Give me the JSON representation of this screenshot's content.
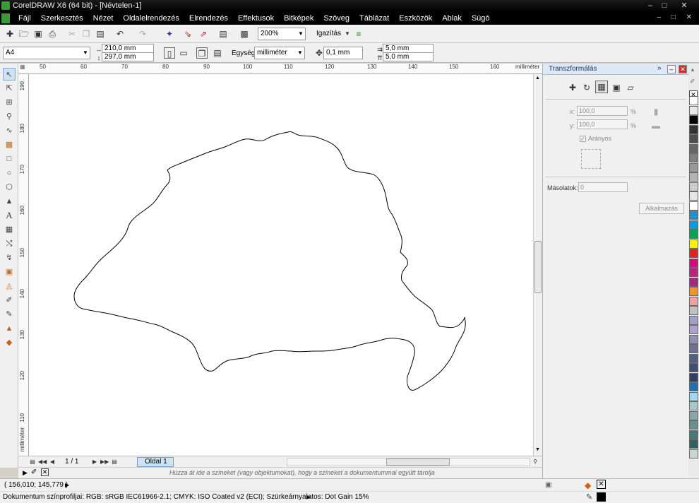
{
  "titlebar": {
    "title": "CorelDRAW X6 (64 bit) - [Névtelen-1]",
    "controls": [
      "minimize-icon",
      "maximize-icon",
      "close-icon"
    ]
  },
  "menubar": {
    "items": [
      "Fájl",
      "Szerkesztés",
      "Nézet",
      "Oldalelrendezés",
      "Elrendezés",
      "Effektusok",
      "Bitképek",
      "Szöveg",
      "Táblázat",
      "Eszközök",
      "Ablak",
      "Súgó"
    ]
  },
  "stdbar": {
    "zoom": "200%",
    "snap_label": "Igazítás"
  },
  "propbar": {
    "page_size": "A4",
    "width": "210,0 mm",
    "height": "297,0 mm",
    "units_label": "Egység:",
    "units": "milliméter",
    "nudge": "0,1 mm",
    "dup_x": "5,0 mm",
    "dup_y": "5,0 mm"
  },
  "ruler": {
    "h_ticks": [
      "50",
      "60",
      "70",
      "80",
      "90",
      "100",
      "110",
      "120",
      "130",
      "140",
      "150",
      "160"
    ],
    "h_unit": "milliméter",
    "v_ticks": [
      "190",
      "180",
      "170",
      "160",
      "150",
      "140",
      "130",
      "120",
      "110"
    ],
    "v_unit": "milliméter"
  },
  "pagenav": {
    "count": "1 / 1",
    "tab": "Oldal 1"
  },
  "hint": "Húzza át ide a színeket (vagy objektumokat), hogy a színeket a dokumentummal együtt tárolja",
  "docker": {
    "title": "Transzformálás",
    "x_label": "x:",
    "x_value": "100,0",
    "y_label": "y:",
    "y_value": "100,0",
    "pct": "%",
    "proportional": "Arányos",
    "copies_label": "Másolatok:",
    "copies_value": "0",
    "apply": "Alkalmazás"
  },
  "status": {
    "coords": "( 156,010; 145,779 )",
    "profile": "Dokumentum színprofiljai: RGB: sRGB IEC61966-2.1; CMYK: ISO Coated v2 (ECI); Szürkeárnyalatos: Dot Gain 15%"
  },
  "palette": [
    "#ffffff",
    "#e8e8e8",
    "#000000",
    "#333333",
    "#4d4d4d",
    "#666666",
    "#808080",
    "#999999",
    "#b3b3b3",
    "#cccccc",
    "#e6e6e6",
    "#ffffff",
    "#1e90d0",
    "#00a0e0",
    "#00a651",
    "#fff200",
    "#ed1c24",
    "#e00080",
    "#c02080",
    "#a02880",
    "#f7941d",
    "#f4a0a0",
    "#c0c0c0",
    "#a0a0c8",
    "#b0a0d0",
    "#9090b0",
    "#707090",
    "#506080",
    "#404e70",
    "#304060",
    "#2070b0",
    "#a0d8f0",
    "#a8c8c8",
    "#88a8a8",
    "#689090",
    "#487878",
    "#306060",
    "#c8d8d0"
  ]
}
